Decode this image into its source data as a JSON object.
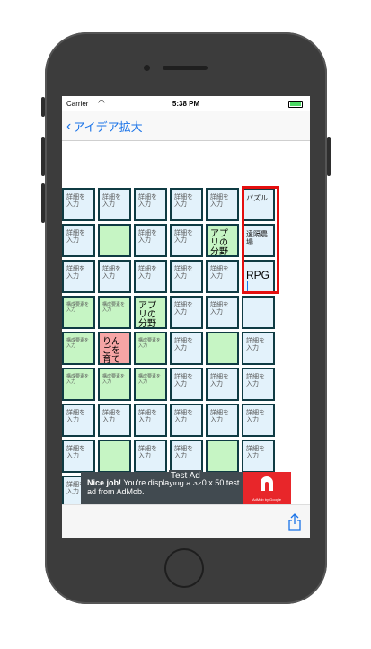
{
  "status": {
    "carrier": "Carrier",
    "time": "5:38 PM"
  },
  "nav": {
    "back_label": "アイデア拡大"
  },
  "grid": [
    [
      {
        "text": "詳細を入力",
        "color": "blue",
        "style": ""
      },
      {
        "text": "詳細を入力",
        "color": "blue",
        "style": ""
      },
      {
        "text": "詳細を入力",
        "color": "blue",
        "style": ""
      },
      {
        "text": "詳細を入力",
        "color": "blue",
        "style": ""
      },
      {
        "text": "詳細を入力",
        "color": "blue",
        "style": ""
      },
      {
        "text": "パズル",
        "color": "blue",
        "style": "dark"
      }
    ],
    [
      {
        "text": "詳細を入力",
        "color": "blue",
        "style": ""
      },
      {
        "text": "",
        "color": "green",
        "style": ""
      },
      {
        "text": "詳細を入力",
        "color": "blue",
        "style": ""
      },
      {
        "text": "詳細を入力",
        "color": "blue",
        "style": ""
      },
      {
        "text": "アプリの分野",
        "color": "green",
        "style": "big"
      },
      {
        "text": "遠隔農場",
        "color": "blue",
        "style": "dark"
      }
    ],
    [
      {
        "text": "詳細を入力",
        "color": "blue",
        "style": ""
      },
      {
        "text": "詳細を入力",
        "color": "blue",
        "style": ""
      },
      {
        "text": "詳細を入力",
        "color": "blue",
        "style": ""
      },
      {
        "text": "詳細を入力",
        "color": "blue",
        "style": ""
      },
      {
        "text": "詳細を入力",
        "color": "blue",
        "style": ""
      },
      {
        "text": "RPG",
        "color": "blue",
        "style": "rpg"
      }
    ],
    [
      {
        "text": "構成要素を入力",
        "color": "green",
        "style": "tiny"
      },
      {
        "text": "構成要素を入力",
        "color": "green",
        "style": "tiny"
      },
      {
        "text": "アプリの分野",
        "color": "green",
        "style": "big"
      },
      {
        "text": "詳細を入力",
        "color": "blue",
        "style": ""
      },
      {
        "text": "詳細を入力",
        "color": "blue",
        "style": ""
      },
      {
        "text": "",
        "color": "blue",
        "style": ""
      }
    ],
    [
      {
        "text": "構成要素を入力",
        "color": "green",
        "style": "tiny"
      },
      {
        "text": "りんごを育てるアプリ",
        "color": "red",
        "style": "big"
      },
      {
        "text": "構成要素を入力",
        "color": "green",
        "style": "tiny"
      },
      {
        "text": "詳細を入力",
        "color": "blue",
        "style": ""
      },
      {
        "text": "",
        "color": "green",
        "style": ""
      },
      {
        "text": "詳細を入力",
        "color": "blue",
        "style": ""
      }
    ],
    [
      {
        "text": "構成要素を入力",
        "color": "green",
        "style": "tiny"
      },
      {
        "text": "構成要素を入力",
        "color": "green",
        "style": "tiny"
      },
      {
        "text": "構成要素を入力",
        "color": "green",
        "style": "tiny"
      },
      {
        "text": "詳細を入力",
        "color": "blue",
        "style": ""
      },
      {
        "text": "詳細を入力",
        "color": "blue",
        "style": ""
      },
      {
        "text": "詳細を入力",
        "color": "blue",
        "style": ""
      }
    ],
    [
      {
        "text": "詳細を入力",
        "color": "blue",
        "style": ""
      },
      {
        "text": "詳細を入力",
        "color": "blue",
        "style": ""
      },
      {
        "text": "詳細を入力",
        "color": "blue",
        "style": ""
      },
      {
        "text": "詳細を入力",
        "color": "blue",
        "style": ""
      },
      {
        "text": "詳細を入力",
        "color": "blue",
        "style": ""
      },
      {
        "text": "詳細を入力",
        "color": "blue",
        "style": ""
      }
    ],
    [
      {
        "text": "詳細を入力",
        "color": "blue",
        "style": ""
      },
      {
        "text": "",
        "color": "green",
        "style": ""
      },
      {
        "text": "詳細を入力",
        "color": "blue",
        "style": ""
      },
      {
        "text": "詳細を入力",
        "color": "blue",
        "style": ""
      },
      {
        "text": "",
        "color": "green",
        "style": ""
      },
      {
        "text": "詳細を入力",
        "color": "blue",
        "style": ""
      }
    ],
    [
      {
        "text": "詳細を入力",
        "color": "blue",
        "style": ""
      },
      {
        "text": "",
        "color": "blue",
        "style": ""
      },
      {
        "text": "",
        "color": "blue",
        "style": ""
      },
      {
        "text": "",
        "color": "blue",
        "style": ""
      },
      {
        "text": "",
        "color": "blue",
        "style": ""
      },
      {
        "text": "",
        "color": "blue",
        "style": ""
      }
    ]
  ],
  "ad": {
    "title": "Nice job!",
    "body": " You're displaying a 320 x 50 test ad from AdMob.",
    "label": "Test Ad",
    "brand": "AdMob by Google"
  },
  "colors": {
    "highlight": "#e40f0f",
    "accent": "#1a73e8"
  }
}
